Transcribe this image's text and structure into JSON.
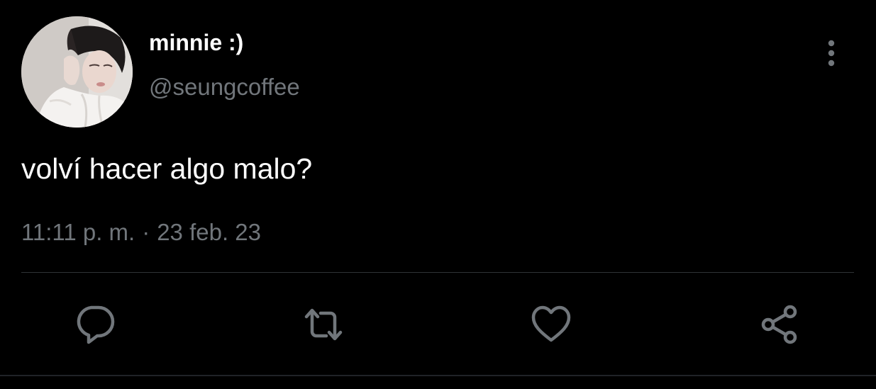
{
  "author": {
    "display_name": "minnie :)",
    "handle": "@seungcoffee"
  },
  "tweet": {
    "text": "volví hacer algo malo?"
  },
  "meta": {
    "time": "11:11 p. m.",
    "separator": "·",
    "date": "23 feb. 23"
  },
  "actions": {
    "reply_icon": "reply-icon",
    "retweet_icon": "retweet-icon",
    "like_icon": "heart-icon",
    "share_icon": "share-icon",
    "more_icon": "more-vertical-icon"
  },
  "colors": {
    "background": "#000000",
    "primary_text": "#ffffff",
    "secondary_text": "#71767b",
    "divider": "#2f3336"
  }
}
